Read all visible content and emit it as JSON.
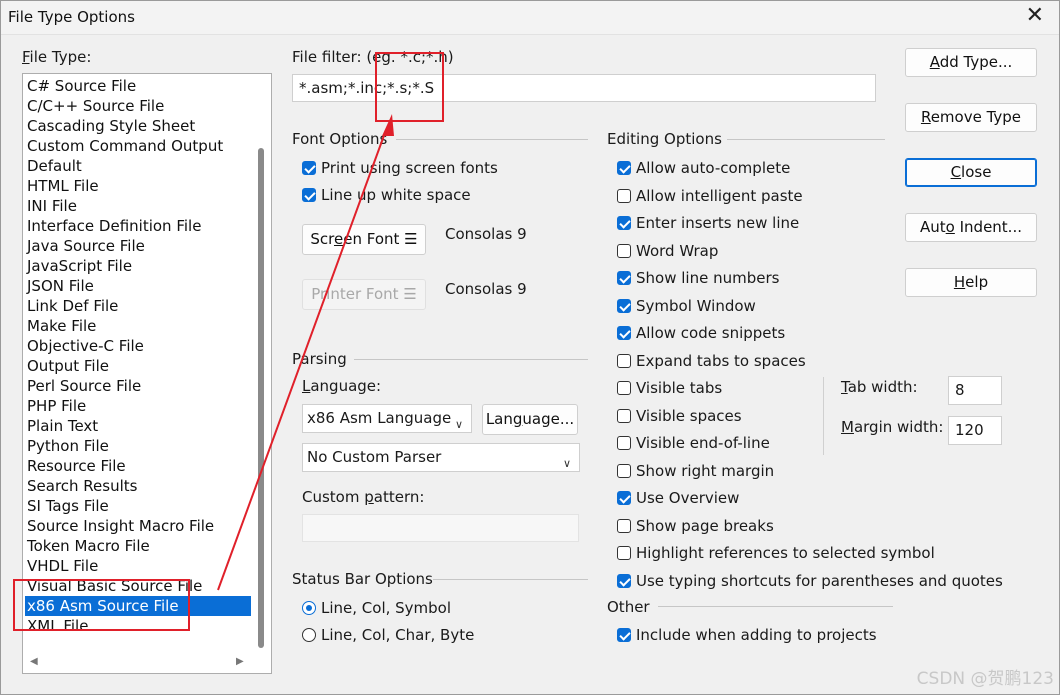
{
  "window": {
    "title": "File Type Options"
  },
  "file_type": {
    "label": "File Type:",
    "items": [
      "C# Source File",
      "C/C++ Source File",
      "Cascading Style Sheet",
      "Custom Command Output",
      "Default",
      "HTML File",
      "INI File",
      "Interface Definition File",
      "Java Source File",
      "JavaScript File",
      "JSON File",
      "Link Def File",
      "Make File",
      "Objective-C File",
      "Output File",
      "Perl Source File",
      "PHP File",
      "Plain Text",
      "Python File",
      "Resource File",
      "Search Results",
      "SI Tags File",
      "Source Insight Macro File",
      "Token Macro File",
      "VHDL File",
      "Visual Basic Source File",
      "x86 Asm Source File",
      "XML File"
    ],
    "selected": "x86 Asm Source File"
  },
  "file_filter": {
    "label": "File filter: (eg. *.c;*.h)",
    "value": "*.asm;*.inc;*.s;*.S"
  },
  "buttons": {
    "add_type": "Add Type...",
    "remove_type": "Remove Type",
    "close": "Close",
    "auto_indent": "Auto Indent...",
    "help": "Help"
  },
  "font_options": {
    "title": "Font Options",
    "print_screen_fonts": {
      "label": "Print using screen fonts",
      "checked": true
    },
    "line_up_white_space": {
      "label": "Line up white space",
      "checked": true
    },
    "screen_font_button": "Screen Font",
    "screen_font_value": "Consolas 9",
    "printer_font_button": "Printer Font",
    "printer_font_value": "Consolas 9"
  },
  "parsing": {
    "title": "Parsing",
    "language_label": "Language:",
    "language_value": "x86 Asm Language",
    "language_button": "Language...",
    "parser_value": "No Custom Parser",
    "custom_pattern_label": "Custom pattern:",
    "custom_pattern_value": ""
  },
  "status_bar": {
    "title": "Status Bar Options",
    "opt1": {
      "label": "Line, Col, Symbol",
      "selected": true
    },
    "opt2": {
      "label": "Line, Col, Char, Byte",
      "selected": false
    }
  },
  "editing": {
    "title": "Editing Options",
    "options": [
      {
        "label": "Allow auto-complete",
        "checked": true
      },
      {
        "label": "Allow intelligent paste",
        "checked": false
      },
      {
        "label": "Enter inserts new line",
        "checked": true
      },
      {
        "label": "Word Wrap",
        "checked": false
      },
      {
        "label": "Show line numbers",
        "checked": true
      },
      {
        "label": "Symbol Window",
        "checked": true
      },
      {
        "label": "Allow code snippets",
        "checked": true
      },
      {
        "label": "Expand tabs to spaces",
        "checked": false
      },
      {
        "label": "Visible tabs",
        "checked": false
      },
      {
        "label": "Visible spaces",
        "checked": false
      },
      {
        "label": "Visible end-of-line",
        "checked": false
      },
      {
        "label": "Show right margin",
        "checked": false
      },
      {
        "label": "Use Overview",
        "checked": true
      },
      {
        "label": "Show page breaks",
        "checked": false
      },
      {
        "label": "Highlight references to selected symbol",
        "checked": false
      },
      {
        "label": "Use typing shortcuts for parentheses and quotes",
        "checked": true
      }
    ],
    "tab_width_label": "Tab width:",
    "tab_width_value": "8",
    "margin_width_label": "Margin width:",
    "margin_width_value": "120"
  },
  "other": {
    "title": "Other",
    "include_projects": {
      "label": "Include when adding to projects",
      "checked": true
    }
  },
  "watermark": "CSDN @贺鹏123",
  "colors": {
    "accent": "#0a6ed6",
    "annotation": "#e0202a"
  }
}
